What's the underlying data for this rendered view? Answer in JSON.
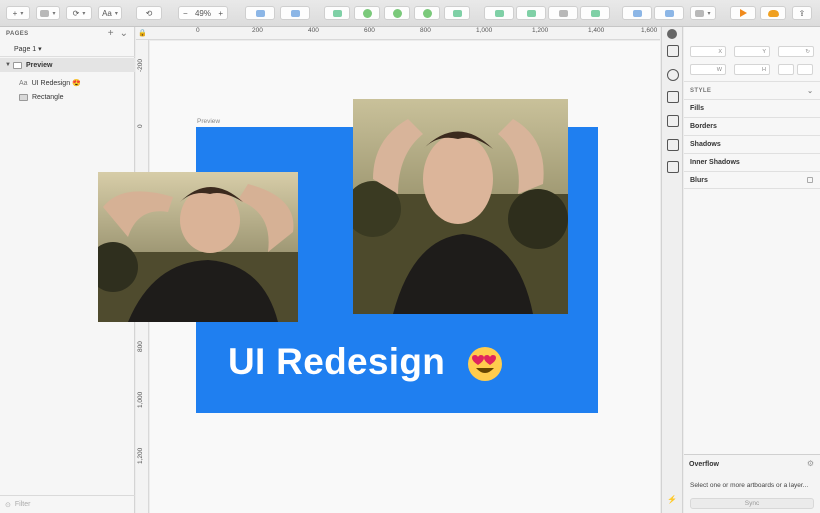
{
  "toolbar": {
    "insert_label": "+",
    "zoom_minus": "−",
    "zoom_value": "49%",
    "zoom_plus": "+",
    "text_label": "Aa"
  },
  "pages_panel": {
    "header": "PAGES",
    "add_icon": "+",
    "collapse_icon": "⌄",
    "current_page": "Page 1",
    "layers": [
      {
        "name": "Preview",
        "kind": "artboard"
      },
      {
        "name": "UI Redesign 😍",
        "kind": "text",
        "icon": "Aa"
      },
      {
        "name": "Rectangle",
        "kind": "shape"
      }
    ],
    "filter_placeholder": "Filter"
  },
  "rulers": {
    "top": [
      "0",
      "200",
      "400",
      "600",
      "800",
      "1,000",
      "1,200",
      "1,400",
      "1,600"
    ],
    "left": [
      "-200",
      "0",
      "800",
      "1,000",
      "1,200"
    ]
  },
  "canvas": {
    "artboard_title": "Preview",
    "headline": "UI Redesign",
    "artboard_color": "#1f7ff0"
  },
  "inspector": {
    "labels": {
      "x": "X",
      "y": "Y",
      "rot": "↻",
      "w": "W",
      "h": "H"
    },
    "style_header": "STYLE",
    "sections": [
      "Fills",
      "Borders",
      "Shadows",
      "Inner Shadows",
      "Blurs"
    ],
    "overflow_title": "Overflow",
    "overflow_message": "Select one or more artboards or a layer...",
    "sync_label": "Sync"
  },
  "colors": {
    "accent": "#1f7ff0",
    "mirror_orange": "#f08a1c",
    "cloud_orange": "#f0a020"
  }
}
